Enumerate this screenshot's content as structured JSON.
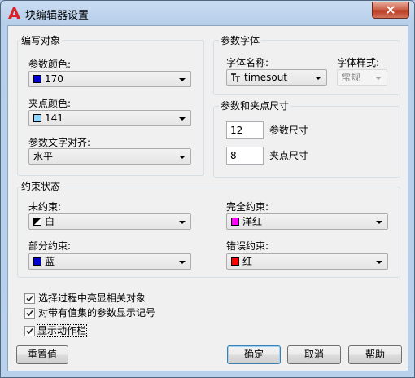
{
  "window": {
    "title": "块编辑器设置"
  },
  "param_object": {
    "group_title": "编写对象",
    "param_color_label": "参数颜色:",
    "param_color_value": "170",
    "param_color_hex": "#0000cc",
    "grip_color_label": "夹点颜色:",
    "grip_color_value": "141",
    "grip_color_hex": "#8fd6ff",
    "align_label": "参数文字对齐:",
    "align_value": "水平"
  },
  "param_font": {
    "group_title": "参数字体",
    "font_name_label": "字体名称:",
    "font_name_value": "timesout",
    "font_style_label": "字体样式:",
    "font_style_value": "常规"
  },
  "param_size": {
    "group_title": "参数和夹点尺寸",
    "param_size_value": "12",
    "param_size_label": "参数尺寸",
    "grip_size_value": "8",
    "grip_size_label": "夹点尺寸"
  },
  "constraint": {
    "group_title": "约束状态",
    "unconstrained_label": "未约束:",
    "unconstrained_value": "白",
    "partial_label": "部分约束:",
    "partial_value": "蓝",
    "partial_hex": "#0000cc",
    "full_label": "完全约束:",
    "full_value": "洋红",
    "full_hex": "#ff00ff",
    "over_label": "错误约束:",
    "over_value": "红",
    "over_hex": "#ff0000"
  },
  "options": [
    {
      "label": "选择过程中亮显相关对象",
      "checked": true
    },
    {
      "label": "对带有值集的参数显示记号",
      "checked": true
    },
    {
      "label": "显示动作栏",
      "checked": true
    }
  ],
  "buttons": {
    "reset": "重置值",
    "ok": "确定",
    "cancel": "取消",
    "help": "帮助"
  }
}
